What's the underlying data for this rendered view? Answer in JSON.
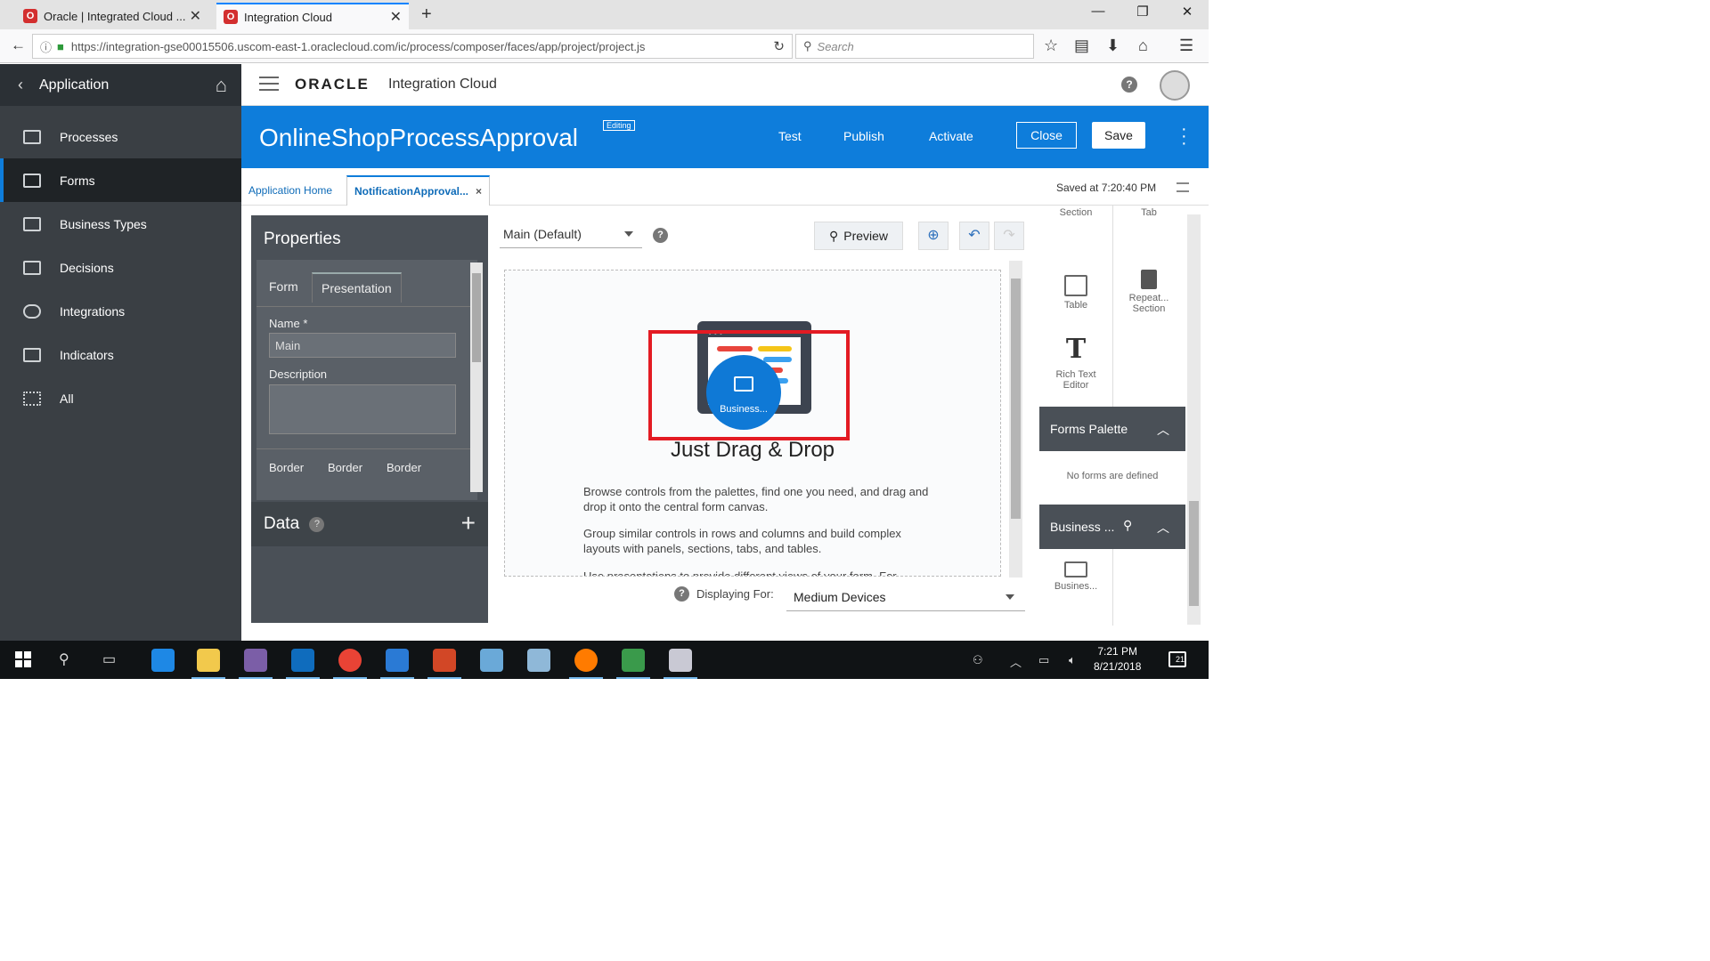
{
  "browser": {
    "tabs": [
      {
        "title": "Oracle | Integrated Cloud ..."
      },
      {
        "title": "Integration Cloud"
      }
    ],
    "url": "https://integration-gse00015506.uscom-east-1.oraclecloud.com/ic/process/composer/faces/app/project/project.js",
    "search_placeholder": "Search"
  },
  "sidebar": {
    "header": "Application",
    "items": [
      {
        "label": "Processes"
      },
      {
        "label": "Forms"
      },
      {
        "label": "Business Types"
      },
      {
        "label": "Decisions"
      },
      {
        "label": "Integrations"
      },
      {
        "label": "Indicators"
      },
      {
        "label": "All"
      }
    ],
    "active_index": 1
  },
  "header": {
    "logo": "ORACLE",
    "product": "Integration Cloud",
    "help": "?"
  },
  "titlebar": {
    "title": "OnlineShopProcessApproval",
    "badge": "Editing",
    "actions": {
      "test": "Test",
      "publish": "Publish",
      "activate": "Activate",
      "close": "Close",
      "save": "Save"
    }
  },
  "doctabs": {
    "home": "Application Home",
    "current": "NotificationApproval...",
    "close": "×",
    "saved": "Saved at 7:20:40 PM"
  },
  "properties": {
    "title": "Properties",
    "tabs": [
      "Form",
      "Presentation"
    ],
    "active_tab": 1,
    "name_label": "Name",
    "required_mark": "*",
    "name_value": "Main",
    "description_label": "Description",
    "border_labels": [
      "Border",
      "Border",
      "Border"
    ]
  },
  "data_panel": {
    "title": "Data",
    "help": "?",
    "add": "+"
  },
  "canvas": {
    "presentation_select": "Main (Default)",
    "help": "?",
    "preview_label": "Preview",
    "illustration_label": "Business...",
    "heading": "Just Drag & Drop",
    "paragraphs": [
      "Browse controls from the palettes, find one you need, and drag and drop it onto the central form canvas.",
      "Group similar controls in rows and columns and build complex layouts with panels, sections, tabs, and tables.",
      "Use presentations to provide different views of your form. For"
    ],
    "displaying_for_label": "Displaying For:",
    "device_select": "Medium Devices"
  },
  "palette": {
    "items_top": [
      {
        "label": "Section"
      },
      {
        "label": "Tab"
      },
      {
        "label": "Table"
      },
      {
        "label": "Repeat... Section"
      },
      {
        "label": "Rich Text Editor"
      }
    ],
    "forms_palette_title": "Forms Palette",
    "no_forms": "No forms are defined",
    "business_title": "Business ...",
    "business_item": "Busines..."
  },
  "taskbar": {
    "time": "7:21 PM",
    "date": "8/21/2018",
    "notifications": "21"
  },
  "colors": {
    "brand_blue": "#0e7ddb",
    "sidebar_bg": "#3a3f44",
    "highlight_red": "#e31b23"
  }
}
